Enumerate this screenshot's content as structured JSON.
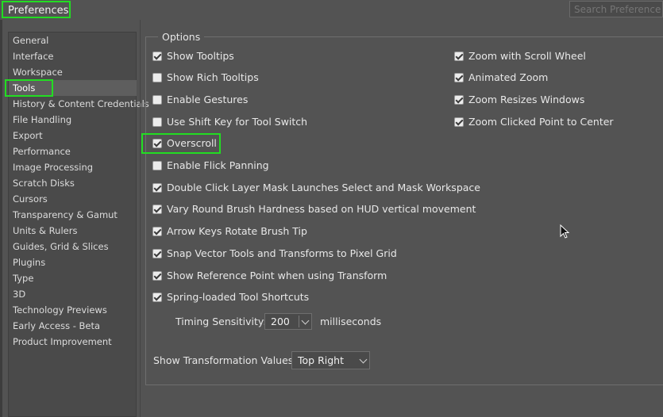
{
  "window": {
    "title": "Preferences"
  },
  "search": {
    "placeholder": "Search Preferences"
  },
  "sidebar": {
    "items": [
      {
        "label": "General"
      },
      {
        "label": "Interface"
      },
      {
        "label": "Workspace"
      },
      {
        "label": "Tools",
        "selected": true
      },
      {
        "label": "History & Content Credentials"
      },
      {
        "label": "File Handling"
      },
      {
        "label": "Export"
      },
      {
        "label": "Performance"
      },
      {
        "label": "Image Processing"
      },
      {
        "label": "Scratch Disks"
      },
      {
        "label": "Cursors"
      },
      {
        "label": "Transparency & Gamut"
      },
      {
        "label": "Units & Rulers"
      },
      {
        "label": "Guides, Grid & Slices"
      },
      {
        "label": "Plugins"
      },
      {
        "label": "Type"
      },
      {
        "label": "3D"
      },
      {
        "label": "Technology Previews"
      },
      {
        "label": "Early Access - Beta"
      },
      {
        "label": "Product Improvement"
      }
    ]
  },
  "options": {
    "group_label": "Options",
    "left_column": [
      {
        "label": "Show Tooltips",
        "checked": true
      },
      {
        "label": "Show Rich Tooltips",
        "checked": false
      },
      {
        "label": "Enable Gestures",
        "checked": false
      },
      {
        "label": "Use Shift Key for Tool Switch",
        "checked": false
      },
      {
        "label": "Overscroll",
        "checked": true
      },
      {
        "label": "Enable Flick Panning",
        "checked": false
      },
      {
        "label": "Double Click Layer Mask Launches Select and Mask Workspace",
        "checked": true
      },
      {
        "label": "Vary Round Brush Hardness based on HUD vertical movement",
        "checked": true
      },
      {
        "label": "Arrow Keys Rotate Brush Tip",
        "checked": true
      },
      {
        "label": "Snap Vector Tools and Transforms to Pixel Grid",
        "checked": true
      },
      {
        "label": "Show Reference Point when using Transform",
        "checked": true
      },
      {
        "label": "Spring-loaded Tool Shortcuts",
        "checked": true
      }
    ],
    "right_column": [
      {
        "label": "Zoom with Scroll Wheel",
        "checked": true
      },
      {
        "label": "Animated Zoom",
        "checked": true
      },
      {
        "label": "Zoom Resizes Windows",
        "checked": true
      },
      {
        "label": "Zoom Clicked Point to Center",
        "checked": true
      }
    ],
    "timing": {
      "label": "Timing Sensitivity:",
      "value": "200",
      "unit": "milliseconds"
    },
    "transform_values": {
      "label": "Show Transformation Values:",
      "value": "Top Right"
    }
  },
  "colors": {
    "background": "#535353",
    "sidebar": "#4a4a4a",
    "highlight": "#22dd22"
  }
}
